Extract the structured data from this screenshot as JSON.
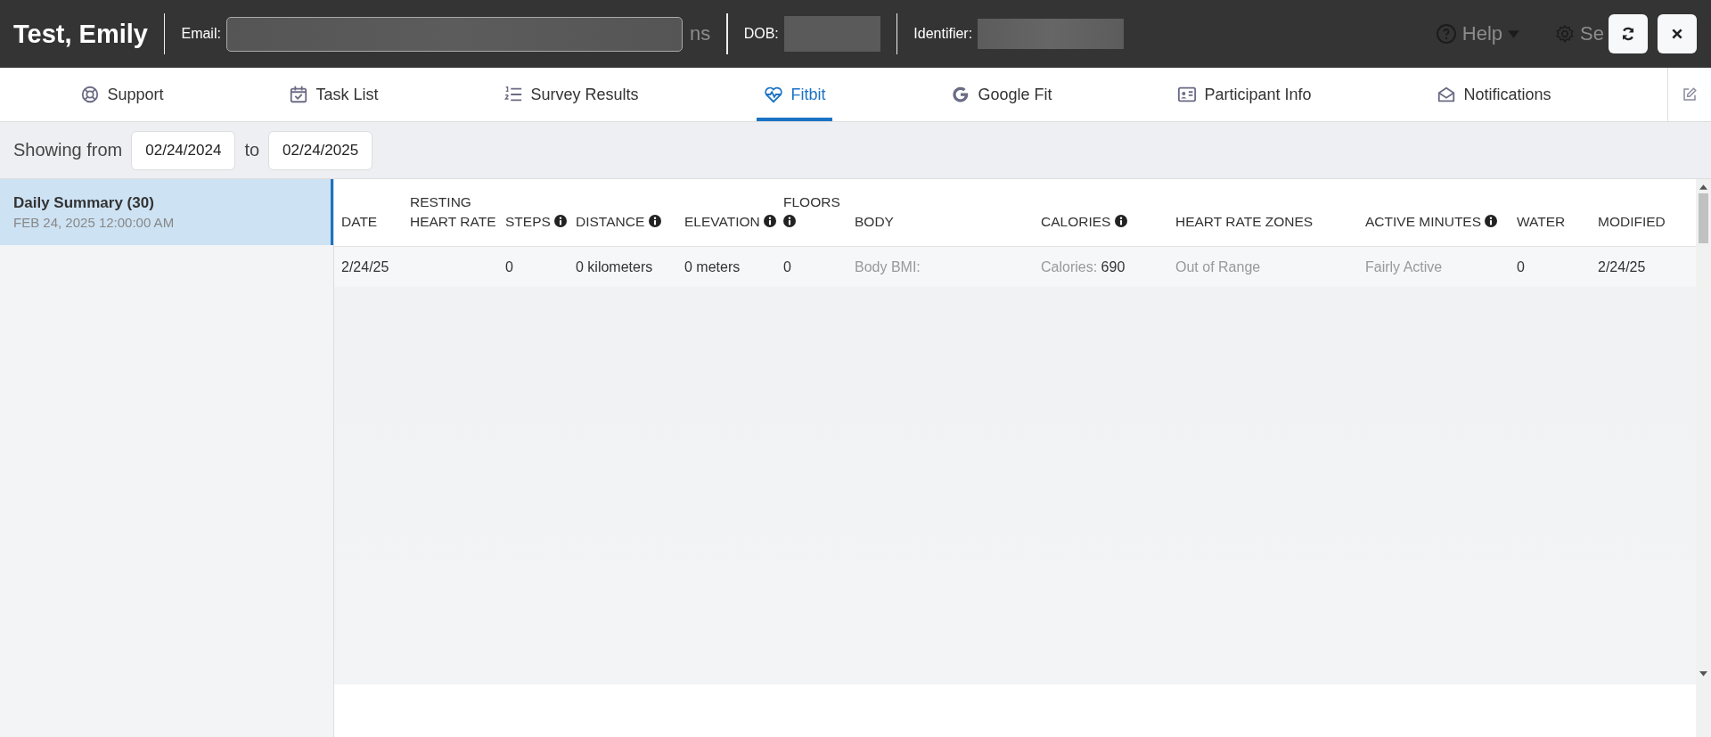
{
  "header": {
    "name": "Test, Emily",
    "fragment": "ns",
    "help": "Help",
    "settings": "Se",
    "fields": [
      {
        "label": "Email:",
        "kind": "email"
      },
      {
        "label": "DOB:",
        "kind": "short"
      },
      {
        "label": "Identifier:",
        "kind": "medium"
      }
    ]
  },
  "tabs": [
    {
      "label": "Support",
      "kind": "support",
      "selected": false
    },
    {
      "label": "Task List",
      "kind": "tasks",
      "selected": false
    },
    {
      "label": "Survey Results",
      "kind": "list",
      "selected": false
    },
    {
      "label": "Fitbit",
      "kind": "heart",
      "selected": true
    },
    {
      "label": "Google Fit",
      "kind": "google",
      "selected": false
    },
    {
      "label": "Participant Info",
      "kind": "card",
      "selected": false
    },
    {
      "label": "Notifications",
      "kind": "envelope",
      "selected": false
    }
  ],
  "filter": {
    "label": "Showing from",
    "from": "02/24/2024",
    "to_label": "to",
    "to": "02/24/2025"
  },
  "sidebar": {
    "items": [
      {
        "title": "Daily Summary (30)",
        "subtitle": "FEB 24, 2025 12:00:00 AM",
        "selected": true
      }
    ]
  },
  "table": {
    "columns": [
      {
        "label": "DATE",
        "info": false
      },
      {
        "label": "RESTING HEART RATE",
        "info": false
      },
      {
        "label": "STEPS",
        "info": true
      },
      {
        "label": "DISTANCE",
        "info": true
      },
      {
        "label": "ELEVATION",
        "info": true
      },
      {
        "label": "FLOORS",
        "info": true
      },
      {
        "label": "BODY",
        "info": false
      },
      {
        "label": "CALORIES",
        "info": true
      },
      {
        "label": "HEART RATE ZONES",
        "info": false
      },
      {
        "label": "ACTIVE MINUTES",
        "info": true
      },
      {
        "label": "WATER",
        "info": false
      },
      {
        "label": "MODIFIED",
        "info": false
      }
    ],
    "rows": [
      [
        {
          "value": "2/24/25"
        },
        {},
        {
          "value": "0"
        },
        {
          "value": "0 kilometers"
        },
        {
          "value": "0 meters"
        },
        {
          "value": "0"
        },
        {
          "label": "Body BMI:"
        },
        {
          "label": "Calories:",
          "value": "690"
        },
        {
          "label": "Out of Range"
        },
        {
          "label": "Fairly Active"
        },
        {
          "value": "0"
        },
        {
          "value": "2/24/25"
        }
      ]
    ]
  }
}
